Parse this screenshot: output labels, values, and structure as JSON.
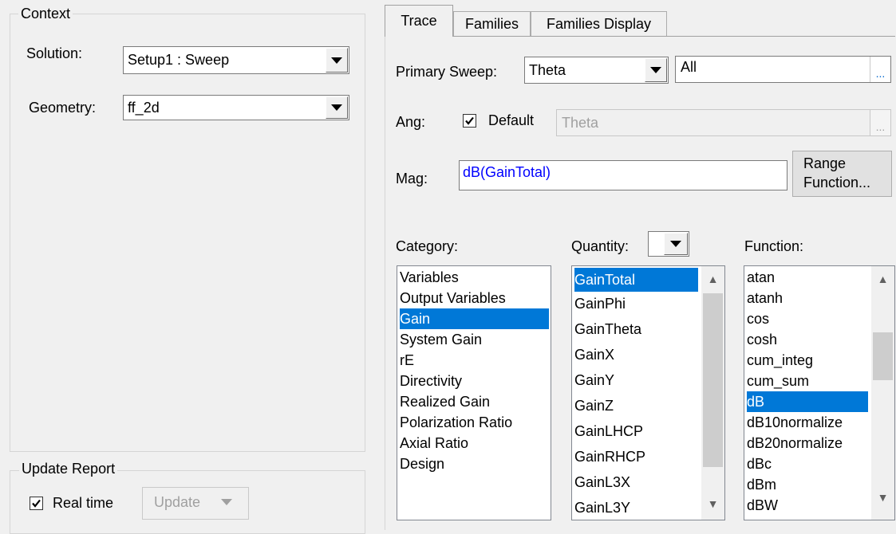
{
  "context": {
    "legend": "Context",
    "solution_label": "Solution:",
    "solution_value": "Setup1 : Sweep",
    "geometry_label": "Geometry:",
    "geometry_value": "ff_2d"
  },
  "update_report": {
    "legend": "Update Report",
    "realtime_label": "Real time",
    "realtime_checked": true,
    "update_button": "Update"
  },
  "tabs": [
    {
      "label": "Trace",
      "active": true
    },
    {
      "label": "Families",
      "active": false
    },
    {
      "label": "Families Display",
      "active": false
    }
  ],
  "trace": {
    "primary_sweep_label": "Primary Sweep:",
    "primary_sweep_value": "Theta",
    "primary_sweep_range": "All",
    "ellipsis": "...",
    "ang_label": "Ang:",
    "default_label": "Default",
    "default_checked": true,
    "ang_value": "Theta",
    "mag_label": "Mag:",
    "mag_value": "dB(GainTotal)",
    "range_function_line1": "Range",
    "range_function_line2": "Function...",
    "category_label": "Category:",
    "quantity_label": "Quantity:",
    "function_label": "Function:",
    "categories": [
      "Variables",
      "Output Variables",
      "Gain",
      "System Gain",
      "rE",
      "Directivity",
      "Realized Gain",
      "Polarization Ratio",
      "Axial Ratio",
      "Design"
    ],
    "category_selected": "Gain",
    "quantities": [
      "GainTotal",
      "GainPhi",
      "GainTheta",
      "GainX",
      "GainY",
      "GainZ",
      "GainLHCP",
      "GainRHCP",
      "GainL3X",
      "GainL3Y"
    ],
    "quantity_selected": "GainTotal",
    "functions": [
      "atan",
      "atanh",
      "cos",
      "cosh",
      "cum_integ",
      "cum_sum",
      "dB",
      "dB10normalize",
      "dB20normalize",
      "dBc",
      "dBm",
      "dBW"
    ],
    "function_selected": "dB"
  },
  "colors": {
    "selection": "#0078d7",
    "mag_text": "#0000ff",
    "disabled_text": "#a0a0a0"
  }
}
